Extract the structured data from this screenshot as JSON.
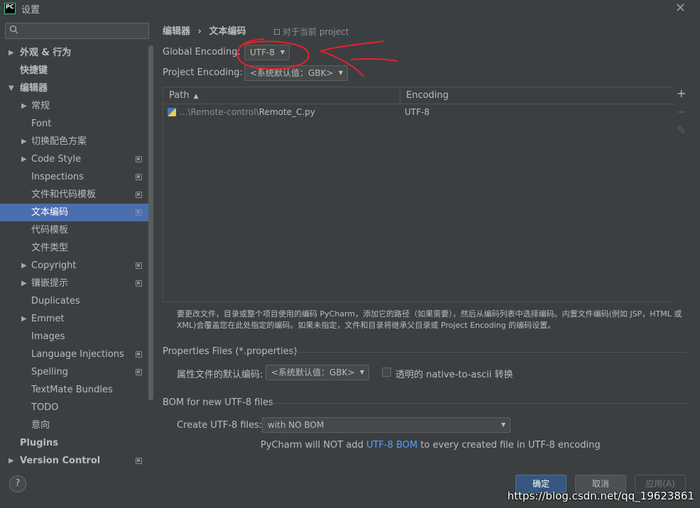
{
  "window": {
    "app_icon_text": "PC",
    "title": "设置",
    "close_glyph": "✕"
  },
  "sidebar": {
    "search_placeholder": "",
    "search_icon": "search-icon",
    "items": [
      {
        "label": "外观 & 行为",
        "level": 0,
        "arrow": "▶",
        "bold": true,
        "project_icon": false
      },
      {
        "label": "快捷键",
        "level": 0,
        "arrow": "",
        "bold": true,
        "project_icon": false
      },
      {
        "label": "编辑器",
        "level": 0,
        "arrow": "▼",
        "bold": true,
        "project_icon": false
      },
      {
        "label": "常规",
        "level": 1,
        "arrow": "▶",
        "project_icon": false
      },
      {
        "label": "Font",
        "level": 1,
        "arrow": "",
        "project_icon": false
      },
      {
        "label": "切换配色方案",
        "level": 1,
        "arrow": "▶",
        "project_icon": false
      },
      {
        "label": "Code Style",
        "level": 1,
        "arrow": "▶",
        "project_icon": true
      },
      {
        "label": "Inspections",
        "level": 1,
        "arrow": "",
        "project_icon": true
      },
      {
        "label": "文件和代码模板",
        "level": 1,
        "arrow": "",
        "project_icon": true
      },
      {
        "label": "文本编码",
        "level": 1,
        "arrow": "",
        "project_icon": true,
        "selected": true
      },
      {
        "label": "代码模板",
        "level": 1,
        "arrow": "",
        "project_icon": false
      },
      {
        "label": "文件类型",
        "level": 1,
        "arrow": "",
        "project_icon": false
      },
      {
        "label": "Copyright",
        "level": 1,
        "arrow": "▶",
        "project_icon": true
      },
      {
        "label": "镶嵌提示",
        "level": 1,
        "arrow": "▶",
        "project_icon": true
      },
      {
        "label": "Duplicates",
        "level": 1,
        "arrow": "",
        "project_icon": false
      },
      {
        "label": "Emmet",
        "level": 1,
        "arrow": "▶",
        "project_icon": false
      },
      {
        "label": "Images",
        "level": 1,
        "arrow": "",
        "project_icon": false
      },
      {
        "label": "Language Injections",
        "level": 1,
        "arrow": "",
        "project_icon": true
      },
      {
        "label": "Spelling",
        "level": 1,
        "arrow": "",
        "project_icon": true
      },
      {
        "label": "TextMate Bundles",
        "level": 1,
        "arrow": "",
        "project_icon": false
      },
      {
        "label": "TODO",
        "level": 1,
        "arrow": "",
        "project_icon": false
      },
      {
        "label": "意向",
        "level": 1,
        "arrow": "",
        "project_icon": false
      },
      {
        "label": "Plugins",
        "level": 0,
        "arrow": "",
        "bold": true,
        "project_icon": false
      },
      {
        "label": "Version Control",
        "level": 0,
        "arrow": "▶",
        "bold": true,
        "project_icon": true
      }
    ]
  },
  "breadcrumb": {
    "parent": "编辑器",
    "separator": "›",
    "current": "文本编码"
  },
  "scope_note": "对于当前 project",
  "global_encoding": {
    "label": "Global Encoding:",
    "value": "UTF-8"
  },
  "project_encoding": {
    "label": "Project Encoding:",
    "value": "<系统默认值：GBK>"
  },
  "table": {
    "columns": [
      "Path",
      "Encoding"
    ],
    "sort_indicator": "▲",
    "rows": [
      {
        "path_prefix": "...\\Remote-control\\",
        "file": "Remote_C.py",
        "encoding": "UTF-8"
      }
    ],
    "tools": {
      "add": "+",
      "remove": "−",
      "edit": "✎"
    }
  },
  "help_text": "要更改文件，目录或整个项目使用的编码 PyCharm，添加它的路径（如果需要），然后从编码列表中选择编码。内置文件编码(例如 JSP，HTML 或 XML)会覆盖您在此处指定的编码。如果未指定，文件和目录将继承父目录或 Project Encoding 的编码设置。",
  "properties_section": {
    "title": "Properties Files (*.properties)",
    "default_label": "属性文件的默认编码:",
    "default_value": "<系统默认值：GBK>",
    "native_checkbox_label": "透明的 native-to-ascii 转换",
    "native_checked": false
  },
  "bom_section": {
    "title": "BOM for new UTF-8 files",
    "create_label": "Create UTF-8 files:",
    "create_value": "with NO BOM",
    "note_before": "PyCharm will NOT add ",
    "note_link": "UTF-8 BOM",
    "note_after": " to every created file in UTF-8 encoding"
  },
  "footer": {
    "help": "?",
    "ok": "确定",
    "cancel": "取消",
    "apply": "应用(A)"
  },
  "watermark": "https://blog.csdn.net/qq_19623861",
  "colors": {
    "background": "#3c3f41",
    "selection": "#4b6eaf",
    "link": "#589df6",
    "annotation": "#e8202a"
  }
}
